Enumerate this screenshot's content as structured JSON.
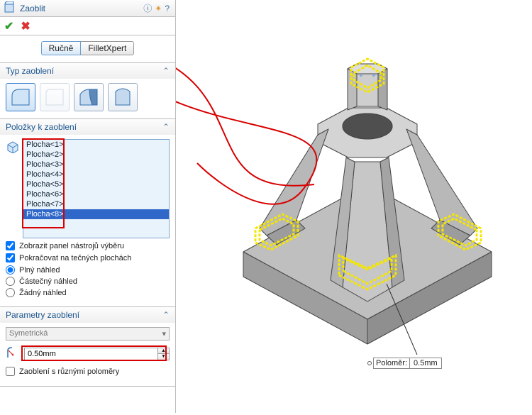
{
  "title": "Zaoblit",
  "tabs": {
    "manual": "Ručně",
    "fxpert": "FilletXpert"
  },
  "section_type": {
    "title": "Typ zaoblení"
  },
  "section_items": {
    "title": "Položky k zaoblení",
    "faces": [
      "Plocha<1>",
      "Plocha<2>",
      "Plocha<3>",
      "Plocha<4>",
      "Plocha<5>",
      "Plocha<6>",
      "Plocha<7>",
      "Plocha<8>"
    ],
    "chk_toolbar": "Zobrazit panel nástrojů výběru",
    "chk_tangent": "Pokračovat na tečných plochách",
    "rad_full": "Plný náhled",
    "rad_part": "Částečný náhled",
    "rad_none": "Žádný náhled"
  },
  "section_params": {
    "title": "Parametry zaoblení",
    "symtype": "Symetrická",
    "radius": "0.50mm",
    "chk_multi": "Zaoblení s různými poloměry"
  },
  "callout": {
    "label": "Poloměr:",
    "value": "0.5mm"
  }
}
